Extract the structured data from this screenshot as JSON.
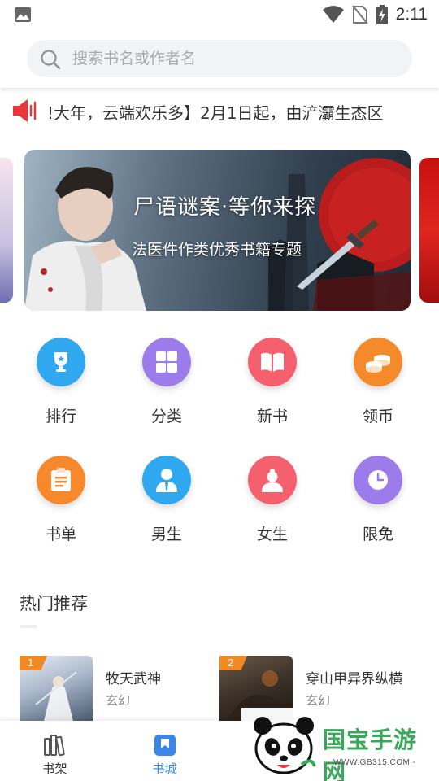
{
  "status_bar": {
    "time": "2:11",
    "icons": [
      "image-icon",
      "wifi-icon",
      "no-sim-icon",
      "battery-charging-icon"
    ]
  },
  "search": {
    "placeholder": "搜索书名或作者名",
    "icon": "search-icon"
  },
  "notice": {
    "icon": "speaker-icon",
    "text": "!大年，云端欢乐多】2月1日起，由浐灞生态区"
  },
  "banner": {
    "title": "尸语谜案·等你来探",
    "subtitle": "法医件作类优秀书籍专题"
  },
  "categories": [
    {
      "label": "排行",
      "icon": "trophy-icon",
      "color": "#2fa8f0"
    },
    {
      "label": "分类",
      "icon": "grid-icon",
      "color": "#9c7bea"
    },
    {
      "label": "新书",
      "icon": "book-open-icon",
      "color": "#f4606e"
    },
    {
      "label": "领币",
      "icon": "coins-icon",
      "color": "#f58a2a"
    },
    {
      "label": "书单",
      "icon": "clipboard-icon",
      "color": "#f7892c"
    },
    {
      "label": "男生",
      "icon": "male-user-icon",
      "color": "#2fa8f0"
    },
    {
      "label": "女生",
      "icon": "female-user-icon",
      "color": "#f4606e"
    },
    {
      "label": "限免",
      "icon": "clock-icon",
      "color": "#9c7bea"
    }
  ],
  "hot": {
    "title": "热门推荐",
    "books": [
      {
        "rank": "1",
        "title": "牧天武神",
        "genre": "玄幻"
      },
      {
        "rank": "2",
        "title": "穿山甲异界纵横",
        "genre": "玄幻"
      }
    ]
  },
  "bottom_nav": [
    {
      "label": "书架",
      "icon": "bookshelf-icon",
      "active": false
    },
    {
      "label": "书城",
      "icon": "bookstore-icon",
      "active": true
    }
  ],
  "watermark": {
    "text": "国宝手游网",
    "url": "- WWW.GB315.COM -"
  }
}
